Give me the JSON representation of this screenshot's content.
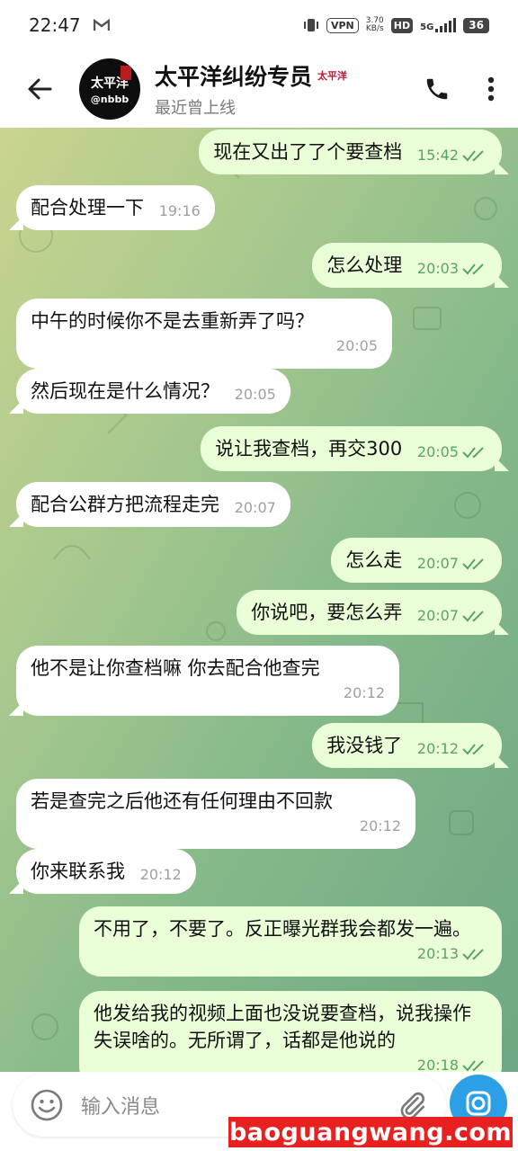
{
  "status_bar": {
    "time": "22:47",
    "notif_icon": "gmail-icon",
    "vpn_label": "VPN",
    "net_speed_top": "3.70",
    "net_speed_bottom": "KB/s",
    "hd_label": "HD",
    "network_label": "5G",
    "battery": "36"
  },
  "header": {
    "title": "太平洋纠纷专员",
    "title_badge": "太平洋",
    "subtitle": "最近曾上线",
    "avatar": {
      "glyph": "太平洋",
      "handle": "@nbbb"
    }
  },
  "messages": [
    {
      "dir": "out",
      "text": "现在又出了了个要查档",
      "time": "15:42",
      "read": true
    },
    {
      "dir": "in",
      "text": "配合处理一下",
      "time": "19:16"
    },
    {
      "dir": "out",
      "text": "怎么处理",
      "time": "20:03",
      "read": true
    },
    {
      "dir": "in",
      "text": "中午的时候你不是去重新弄了吗？",
      "time": "20:05"
    },
    {
      "dir": "in",
      "text": "然后现在是什么情况？",
      "time": "20:05"
    },
    {
      "dir": "out",
      "text": "说让我查档，再交300",
      "time": "20:05",
      "read": true
    },
    {
      "dir": "in",
      "text": "配合公群方把流程走完",
      "time": "20:07"
    },
    {
      "dir": "out",
      "text": "怎么走",
      "time": "20:07",
      "read": true
    },
    {
      "dir": "out",
      "text": "你说吧，要怎么弄",
      "time": "20:07",
      "read": true
    },
    {
      "dir": "in",
      "text": "他不是让你查档嘛 你去配合他查完",
      "time": "20:12"
    },
    {
      "dir": "out",
      "text": "我没钱了",
      "time": "20:12",
      "read": true
    },
    {
      "dir": "in",
      "text": "若是查完之后他还有任何理由不回款",
      "time": "20:12"
    },
    {
      "dir": "in",
      "text": "你来联系我",
      "time": "20:12"
    },
    {
      "dir": "out",
      "text": "不用了，不要了。反正曝光群我会都发一遍。",
      "time": "20:13",
      "read": true
    },
    {
      "dir": "out",
      "text": "他发给我的视频上面也没说要查档，说我操作失误啥的。无所谓了，话都是他说的",
      "time": "20:18",
      "read": true
    }
  ],
  "composer": {
    "placeholder": "输入消息"
  },
  "watermark": "baoguangwang.com",
  "colors": {
    "incoming": "#ffffff",
    "outgoing": "#eaffd8",
    "accent": "#2ca0e6",
    "check": "#5aa45f"
  }
}
